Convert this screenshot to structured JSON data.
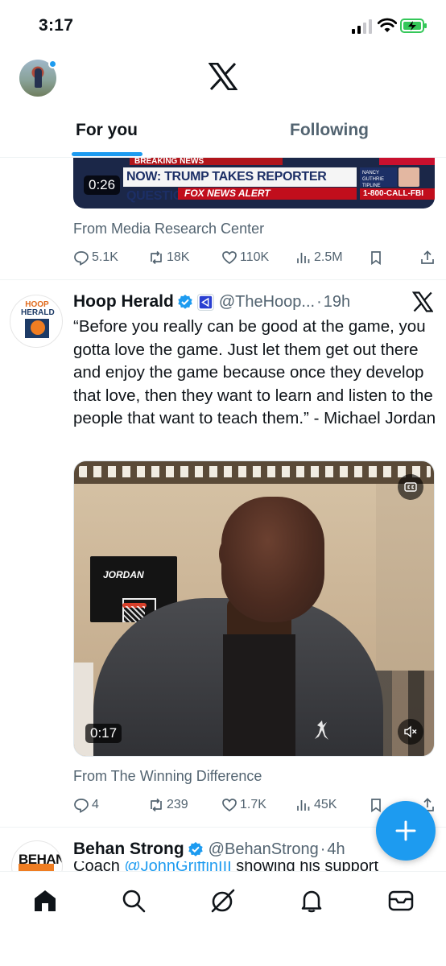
{
  "status_bar": {
    "time": "3:17"
  },
  "header": {
    "tabs": [
      {
        "label": "For you",
        "active": true
      },
      {
        "label": "Following",
        "active": false
      }
    ]
  },
  "tweet1": {
    "video": {
      "breaking": "BREAKING NEWS",
      "headline": "NOW: TRUMP TAKES REPORTER QUESTIONS",
      "subline": "FOX NEWS ALERT",
      "sidebox": "NANCY GUTHRIE TIPLINE",
      "phone": "1-800-CALL-FBI",
      "duration": "0:26"
    },
    "from": "From Media Research Center",
    "stats": {
      "replies": "5.1K",
      "reposts": "18K",
      "likes": "110K",
      "views": "2.5M"
    }
  },
  "tweet2": {
    "avatar_text": [
      "HOOP",
      "HERALD"
    ],
    "name": "Hoop Herald",
    "handle": "@TheHoop...",
    "time": "19h",
    "body": "“Before you really can be good at the game, you gotta love the game. Just let them get out there and enjoy the game because once they develop that love, then they want to learn and listen to the people that want to teach them.” - Michael Jordan",
    "video": {
      "duration": "0:17",
      "board_text": "JORDAN"
    },
    "from": "From The Winning Difference",
    "stats": {
      "replies": "4",
      "reposts": "239",
      "likes": "1.7K",
      "views": "45K"
    }
  },
  "tweet3": {
    "avatar_text": "BEHAN",
    "name": "Behan Strong",
    "handle": "@BehanStrong",
    "time": "4h",
    "body_prefix": "Coach ",
    "mention": "@JohnGriffinIII",
    "body_suffix": " showing his support"
  },
  "colors": {
    "accent": "#1d9bf0",
    "text": "#0f1419",
    "muted": "#536471"
  },
  "icons": [
    "x-logo",
    "verified-badge",
    "reply-icon",
    "repost-icon",
    "like-icon",
    "views-icon",
    "bookmark-icon",
    "share-icon",
    "compose-icon",
    "home-icon",
    "search-icon",
    "grok-icon",
    "bell-icon",
    "mail-icon"
  ]
}
